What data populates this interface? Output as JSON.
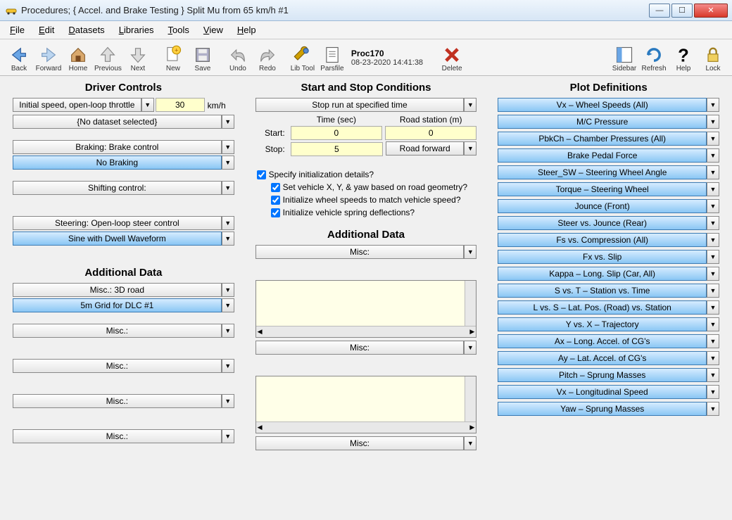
{
  "window": {
    "title": "Procedures;   { Accel. and Brake Testing }   Split Mu from 65 km/h #1"
  },
  "menu": [
    "File",
    "Edit",
    "Datasets",
    "Libraries",
    "Tools",
    "View",
    "Help"
  ],
  "toolbar": {
    "back": "Back",
    "forward": "Forward",
    "home": "Home",
    "previous": "Previous",
    "next": "Next",
    "new": "New",
    "save": "Save",
    "undo": "Undo",
    "redo": "Redo",
    "libtool": "Lib Tool",
    "parsfile": "Parsfile",
    "delete": "Delete",
    "sidebar": "Sidebar",
    "refresh": "Refresh",
    "help": "Help",
    "lock": "Lock",
    "proc_name": "Proc170",
    "proc_ts": "08-23-2020 14:41:38"
  },
  "col1": {
    "heading": "Driver Controls",
    "speed_mode": "Initial speed, open-loop throttle",
    "speed_value": "30",
    "speed_unit": "km/h",
    "dataset": "{No dataset selected}",
    "brake_mode": "Braking: Brake control",
    "brake_value": "No Braking",
    "shift_mode": "Shifting control:",
    "steer_mode": "Steering: Open-loop steer control",
    "steer_value": "Sine with Dwell Waveform",
    "add_heading": "Additional Data",
    "add1_mode": "Misc.: 3D road",
    "add1_value": "5m Grid for DLC #1",
    "add2_mode": "Misc.:",
    "add3_mode": "Misc.:",
    "add4_mode": "Misc.:",
    "add5_mode": "Misc.:"
  },
  "col2": {
    "heading": "Start and Stop Conditions",
    "stop_mode": "Stop run at specified time",
    "hdr_time": "Time (sec)",
    "hdr_station": "Road station (m)",
    "lbl_start": "Start:",
    "lbl_stop": "Stop:",
    "start_time": "0",
    "start_station": "0",
    "stop_time": "5",
    "road_dir": "Road forward",
    "chk_init": "Specify initialization details?",
    "chk_xy": "Set vehicle X, Y, & yaw based on road geometry?",
    "chk_wheel": "Initialize wheel speeds to match vehicle speed?",
    "chk_spring": "Initialize vehicle spring deflections?",
    "add_heading": "Additional Data",
    "misc1": "Misc:",
    "misc2": "Misc:",
    "misc3": "Misc:"
  },
  "col3": {
    "heading": "Plot Definitions",
    "plots": [
      "Vx – Wheel Speeds (All)",
      "M/C Pressure",
      "PbkCh – Chamber Pressures (All)",
      "Brake Pedal Force",
      "Steer_SW – Steering Wheel Angle",
      "Torque – Steering Wheel",
      "Jounce (Front)",
      "Steer vs. Jounce (Rear)",
      "Fs vs. Compression (All)",
      "Fx vs. Slip",
      "Kappa – Long. Slip (Car, All)",
      "S vs. T – Station vs. Time",
      "L vs. S – Lat. Pos. (Road) vs. Station",
      "Y vs. X – Trajectory",
      "Ax – Long. Accel. of CG's",
      "Ay – Lat. Accel. of CG's",
      "Pitch – Sprung Masses",
      "Vx – Longitudinal Speed",
      "Yaw – Sprung Masses"
    ]
  }
}
